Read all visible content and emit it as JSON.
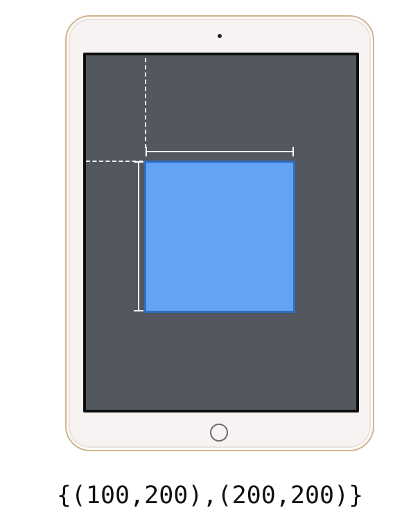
{
  "caption": {
    "text": "{(100,200),(200,200)}"
  },
  "icons": {
    "device": "ipad-icon",
    "camera": "camera-dot-icon",
    "home": "home-button-icon"
  },
  "colors": {
    "screen": "#53575f",
    "rect_fill": "#63a3f3",
    "rect_border": "#2f6fc2",
    "device_body": "#f6f3f2",
    "device_trim": "#d2b48f",
    "guides": "#ffffff"
  }
}
